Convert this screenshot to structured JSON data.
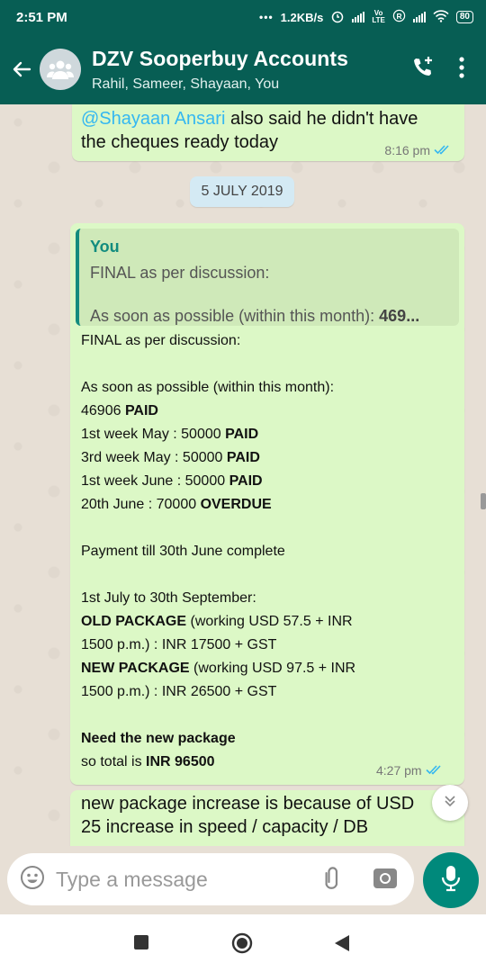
{
  "status_bar": {
    "time": "2:51 PM",
    "dots": "•••",
    "speed": "1.2KB/s",
    "battery": "80"
  },
  "header": {
    "title": "DZV Sooperbuy Accounts",
    "subtitle": "Rahil, Sameer, Shayaan, You"
  },
  "messages": {
    "m1": {
      "mention": "@Shayaan Ansari",
      "line1_rest": " also said he didn't have",
      "line2": "the cheques ready today",
      "time": "8:16 pm"
    },
    "date_divider": "5 JULY 2019",
    "m2": {
      "quote_author": "You",
      "quote_line1": "FINAL as per discussion:",
      "quote_line2": "As soon as possible (within this month): ",
      "quote_line2_bold": "469...",
      "lines": [
        {
          "text": "FINAL as per discussion:",
          "bold": ""
        },
        {
          "text": "",
          "bold": ""
        },
        {
          "text": "As soon as possible (within this month):",
          "bold": ""
        },
        {
          "text": "46906 ",
          "bold": "PAID"
        },
        {
          "text": "1st week May : 50000 ",
          "bold": "PAID"
        },
        {
          "text": "3rd week May : 50000 ",
          "bold": "PAID"
        },
        {
          "text": "1st week June : 50000 ",
          "bold": "PAID"
        },
        {
          "text": "20th June : 70000 ",
          "bold": "OVERDUE"
        },
        {
          "text": "",
          "bold": ""
        },
        {
          "text": "Payment till 30th June complete",
          "bold": ""
        },
        {
          "text": "",
          "bold": ""
        },
        {
          "text": "1st July to 30th September:",
          "bold": ""
        },
        {
          "bold_first": "OLD PACKAGE",
          "text": " (working USD 57.5 + INR"
        },
        {
          "text": "1500 p.m.) : INR 17500 + GST",
          "bold": ""
        },
        {
          "bold_first": "NEW PACKAGE",
          "text": " (working USD 97.5 + INR"
        },
        {
          "text": "1500 p.m.) : INR 26500 + GST",
          "bold": ""
        },
        {
          "text": "",
          "bold": ""
        },
        {
          "bold_first": "Need the new package",
          "text": ""
        },
        {
          "text": "so total is ",
          "bold": "INR 96500"
        }
      ],
      "time": "4:27 pm"
    },
    "m3": {
      "line1": "new package increase is because of USD",
      "line2": "25 increase in speed / capacity / DB"
    }
  },
  "input": {
    "placeholder": "Type a message"
  },
  "colors": {
    "header": "#075e54",
    "outgoing_bubble": "#dcf8c6",
    "accent": "#128c7e",
    "read_ticks": "#34b7f1",
    "mic_button": "#00897b"
  },
  "icons": [
    "back-arrow-icon",
    "group-avatar-icon",
    "add-call-icon",
    "more-vert-icon",
    "double-check-icon",
    "chevron-down-icon",
    "emoji-icon",
    "attach-icon",
    "camera-icon",
    "mic-icon",
    "nav-recents-icon",
    "nav-home-icon",
    "nav-back-icon"
  ]
}
